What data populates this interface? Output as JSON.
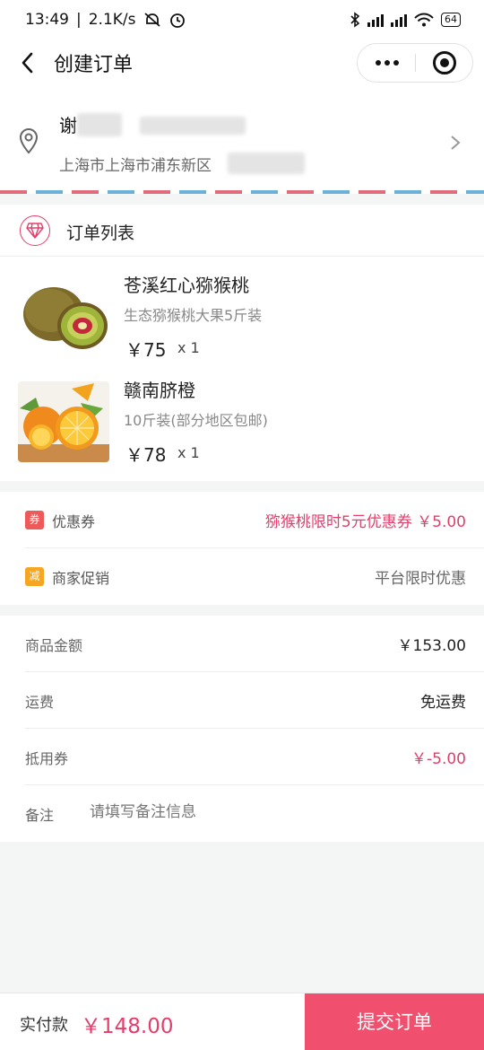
{
  "status_bar": {
    "time": "13:49",
    "network_speed": "2.1K/s",
    "battery": "64",
    "icons": [
      "mute-icon",
      "alarm-icon",
      "bluetooth-icon",
      "hd-icon",
      "signal-icon",
      "wifi-icon",
      "battery-icon"
    ]
  },
  "nav": {
    "title": "创建订单",
    "icons": [
      "back-icon",
      "more-icon",
      "close-circle-icon"
    ]
  },
  "address": {
    "name": "谢",
    "line": "上海市上海市浦东新区",
    "icons": [
      "location-pin-icon",
      "chevron-right-icon"
    ]
  },
  "orders": {
    "title": "订单列表",
    "icon": "diamond-icon",
    "items": [
      {
        "name": "苍溪红心猕猴桃",
        "desc": "生态猕猴桃大果5斤装",
        "price": "￥75",
        "qty": "x 1",
        "image": "kiwi-image"
      },
      {
        "name": "赣南脐橙",
        "desc": "10斤装(部分地区包邮)",
        "price": "￥78",
        "qty": "x 1",
        "image": "orange-image"
      }
    ]
  },
  "promotions": {
    "coupon": {
      "tag": "券",
      "label": "优惠券",
      "value": "猕猴桃限时5元优惠券 ￥5.00"
    },
    "merchant": {
      "tag": "减",
      "label": "商家促销",
      "value": "平台限时优惠"
    }
  },
  "summary": {
    "goods_label": "商品金额",
    "goods_value": "￥153.00",
    "shipping_label": "运费",
    "shipping_value": "免运费",
    "voucher_label": "抵用券",
    "voucher_value": "￥-5.00",
    "remark_label": "备注",
    "remark_placeholder": "请填写备注信息",
    "remark_value": ""
  },
  "footer": {
    "pay_label": "实付款",
    "pay_amount": "￥148.00",
    "submit_label": "提交订单"
  },
  "colors": {
    "accent": "#e33e6b",
    "submit_bg": "#f04f6e",
    "coupon_tag": "#ee5a5a",
    "merchant_tag": "#f5a623"
  }
}
